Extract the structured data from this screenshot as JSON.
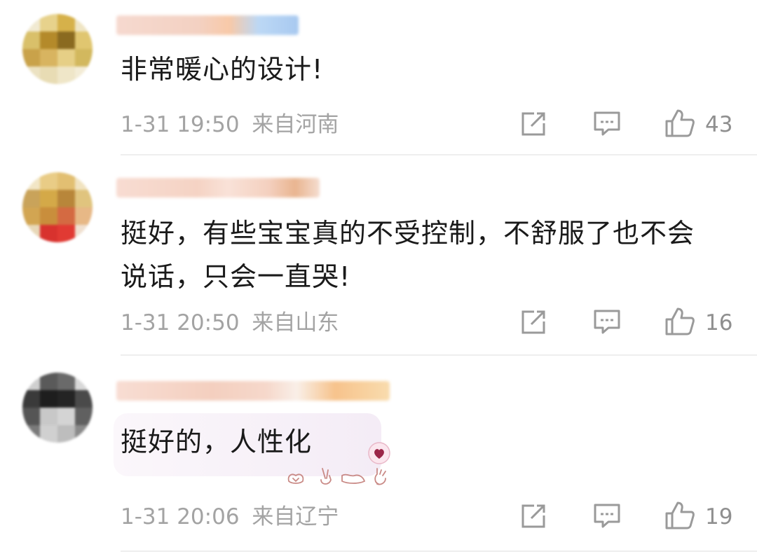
{
  "comments": [
    {
      "text_lines": [
        "非常暖心的设计!"
      ],
      "time": "1-31 19:50",
      "location": "来自河南",
      "likes": "43"
    },
    {
      "text_lines": [
        "挺好，有些宝宝真的不受控制，不舒服了也不会",
        "说话，只会一直哭!"
      ],
      "time": "1-31 20:50",
      "location": "来自山东",
      "likes": "16"
    },
    {
      "text_lines": [
        "挺好的，人性化"
      ],
      "time": "1-31 20:06",
      "location": "来自辽宁",
      "likes": "19"
    }
  ],
  "icons": {
    "share": "share-icon",
    "reply": "comment-icon",
    "like": "thumbs-up-icon"
  },
  "colors": {
    "text": "#1a1a1a",
    "meta": "#a3a3a3",
    "icon": "#9a9a9a"
  }
}
